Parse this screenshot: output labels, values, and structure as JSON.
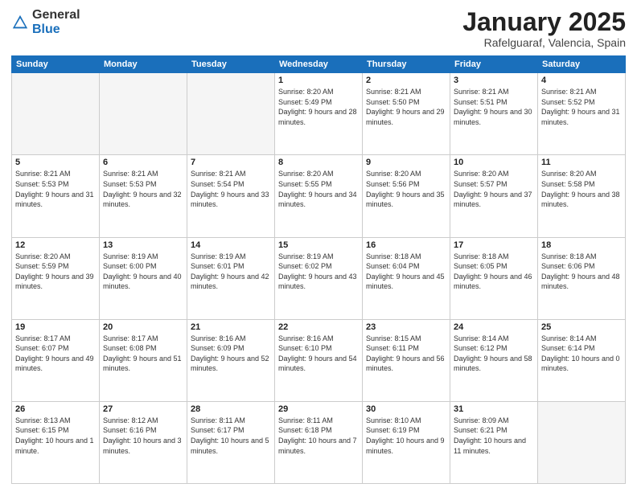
{
  "logo": {
    "general": "General",
    "blue": "Blue"
  },
  "header": {
    "month": "January 2025",
    "location": "Rafelguaraf, Valencia, Spain"
  },
  "weekdays": [
    "Sunday",
    "Monday",
    "Tuesday",
    "Wednesday",
    "Thursday",
    "Friday",
    "Saturday"
  ],
  "weeks": [
    [
      {
        "day": "",
        "info": ""
      },
      {
        "day": "",
        "info": ""
      },
      {
        "day": "",
        "info": ""
      },
      {
        "day": "1",
        "info": "Sunrise: 8:20 AM\nSunset: 5:49 PM\nDaylight: 9 hours\nand 28 minutes."
      },
      {
        "day": "2",
        "info": "Sunrise: 8:21 AM\nSunset: 5:50 PM\nDaylight: 9 hours\nand 29 minutes."
      },
      {
        "day": "3",
        "info": "Sunrise: 8:21 AM\nSunset: 5:51 PM\nDaylight: 9 hours\nand 30 minutes."
      },
      {
        "day": "4",
        "info": "Sunrise: 8:21 AM\nSunset: 5:52 PM\nDaylight: 9 hours\nand 31 minutes."
      }
    ],
    [
      {
        "day": "5",
        "info": "Sunrise: 8:21 AM\nSunset: 5:53 PM\nDaylight: 9 hours\nand 31 minutes."
      },
      {
        "day": "6",
        "info": "Sunrise: 8:21 AM\nSunset: 5:53 PM\nDaylight: 9 hours\nand 32 minutes."
      },
      {
        "day": "7",
        "info": "Sunrise: 8:21 AM\nSunset: 5:54 PM\nDaylight: 9 hours\nand 33 minutes."
      },
      {
        "day": "8",
        "info": "Sunrise: 8:20 AM\nSunset: 5:55 PM\nDaylight: 9 hours\nand 34 minutes."
      },
      {
        "day": "9",
        "info": "Sunrise: 8:20 AM\nSunset: 5:56 PM\nDaylight: 9 hours\nand 35 minutes."
      },
      {
        "day": "10",
        "info": "Sunrise: 8:20 AM\nSunset: 5:57 PM\nDaylight: 9 hours\nand 37 minutes."
      },
      {
        "day": "11",
        "info": "Sunrise: 8:20 AM\nSunset: 5:58 PM\nDaylight: 9 hours\nand 38 minutes."
      }
    ],
    [
      {
        "day": "12",
        "info": "Sunrise: 8:20 AM\nSunset: 5:59 PM\nDaylight: 9 hours\nand 39 minutes."
      },
      {
        "day": "13",
        "info": "Sunrise: 8:19 AM\nSunset: 6:00 PM\nDaylight: 9 hours\nand 40 minutes."
      },
      {
        "day": "14",
        "info": "Sunrise: 8:19 AM\nSunset: 6:01 PM\nDaylight: 9 hours\nand 42 minutes."
      },
      {
        "day": "15",
        "info": "Sunrise: 8:19 AM\nSunset: 6:02 PM\nDaylight: 9 hours\nand 43 minutes."
      },
      {
        "day": "16",
        "info": "Sunrise: 8:18 AM\nSunset: 6:04 PM\nDaylight: 9 hours\nand 45 minutes."
      },
      {
        "day": "17",
        "info": "Sunrise: 8:18 AM\nSunset: 6:05 PM\nDaylight: 9 hours\nand 46 minutes."
      },
      {
        "day": "18",
        "info": "Sunrise: 8:18 AM\nSunset: 6:06 PM\nDaylight: 9 hours\nand 48 minutes."
      }
    ],
    [
      {
        "day": "19",
        "info": "Sunrise: 8:17 AM\nSunset: 6:07 PM\nDaylight: 9 hours\nand 49 minutes."
      },
      {
        "day": "20",
        "info": "Sunrise: 8:17 AM\nSunset: 6:08 PM\nDaylight: 9 hours\nand 51 minutes."
      },
      {
        "day": "21",
        "info": "Sunrise: 8:16 AM\nSunset: 6:09 PM\nDaylight: 9 hours\nand 52 minutes."
      },
      {
        "day": "22",
        "info": "Sunrise: 8:16 AM\nSunset: 6:10 PM\nDaylight: 9 hours\nand 54 minutes."
      },
      {
        "day": "23",
        "info": "Sunrise: 8:15 AM\nSunset: 6:11 PM\nDaylight: 9 hours\nand 56 minutes."
      },
      {
        "day": "24",
        "info": "Sunrise: 8:14 AM\nSunset: 6:12 PM\nDaylight: 9 hours\nand 58 minutes."
      },
      {
        "day": "25",
        "info": "Sunrise: 8:14 AM\nSunset: 6:14 PM\nDaylight: 10 hours\nand 0 minutes."
      }
    ],
    [
      {
        "day": "26",
        "info": "Sunrise: 8:13 AM\nSunset: 6:15 PM\nDaylight: 10 hours\nand 1 minute."
      },
      {
        "day": "27",
        "info": "Sunrise: 8:12 AM\nSunset: 6:16 PM\nDaylight: 10 hours\nand 3 minutes."
      },
      {
        "day": "28",
        "info": "Sunrise: 8:11 AM\nSunset: 6:17 PM\nDaylight: 10 hours\nand 5 minutes."
      },
      {
        "day": "29",
        "info": "Sunrise: 8:11 AM\nSunset: 6:18 PM\nDaylight: 10 hours\nand 7 minutes."
      },
      {
        "day": "30",
        "info": "Sunrise: 8:10 AM\nSunset: 6:19 PM\nDaylight: 10 hours\nand 9 minutes."
      },
      {
        "day": "31",
        "info": "Sunrise: 8:09 AM\nSunset: 6:21 PM\nDaylight: 10 hours\nand 11 minutes."
      },
      {
        "day": "",
        "info": ""
      }
    ]
  ]
}
